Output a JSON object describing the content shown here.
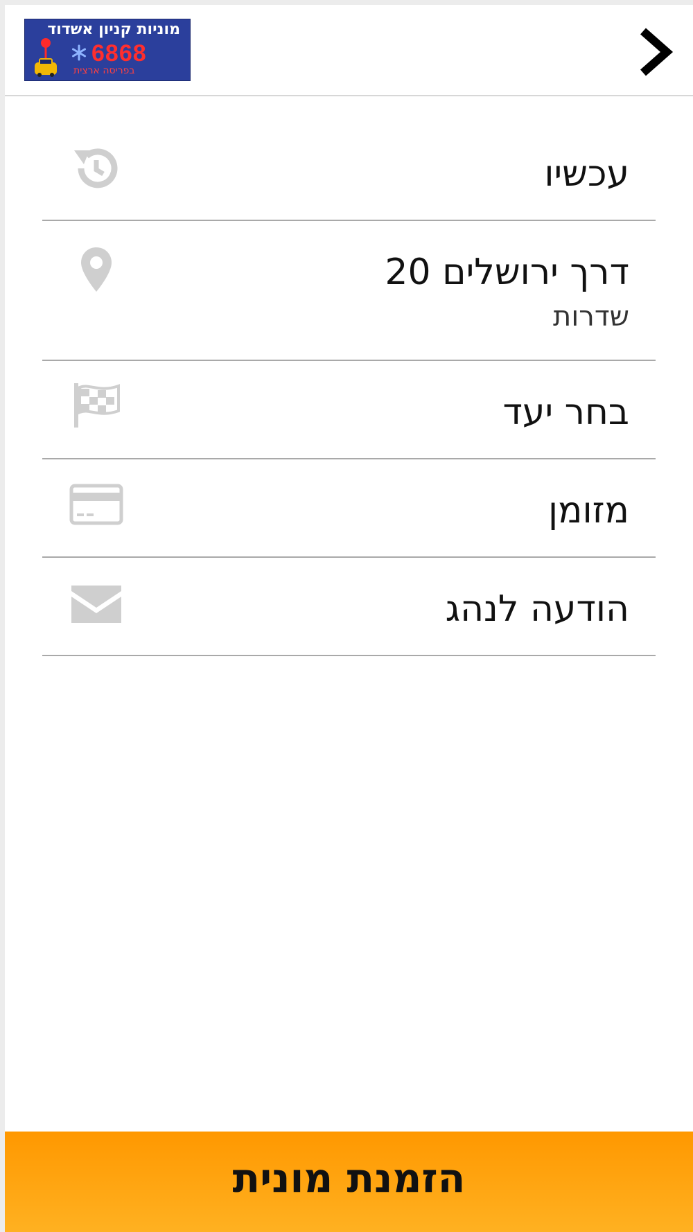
{
  "header": {
    "back_icon": "chevron-right-icon",
    "logo": {
      "line1": "מוניות קניון אשדוד",
      "phone": "6868",
      "line3": "בפריסה ארצית"
    }
  },
  "rows": [
    {
      "label": "עכשיו",
      "icon": "history-clock-icon"
    },
    {
      "label": "דרך ירושלים 20",
      "sub": "שדרות",
      "icon": "map-pin-icon"
    },
    {
      "label": "בחר יעד",
      "icon": "checkered-flag-icon"
    },
    {
      "label": "מזומן",
      "icon": "credit-card-icon"
    },
    {
      "label": "הודעה לנהג",
      "icon": "envelope-icon"
    }
  ],
  "order_button": {
    "label": "הזמנת מונית"
  },
  "colors": {
    "accent": "#ff9800",
    "icon_gray": "#cfcfcf",
    "divider": "#a9a9a9",
    "logo_bg": "#2b3f9c",
    "logo_phone": "#ff2e2e"
  }
}
